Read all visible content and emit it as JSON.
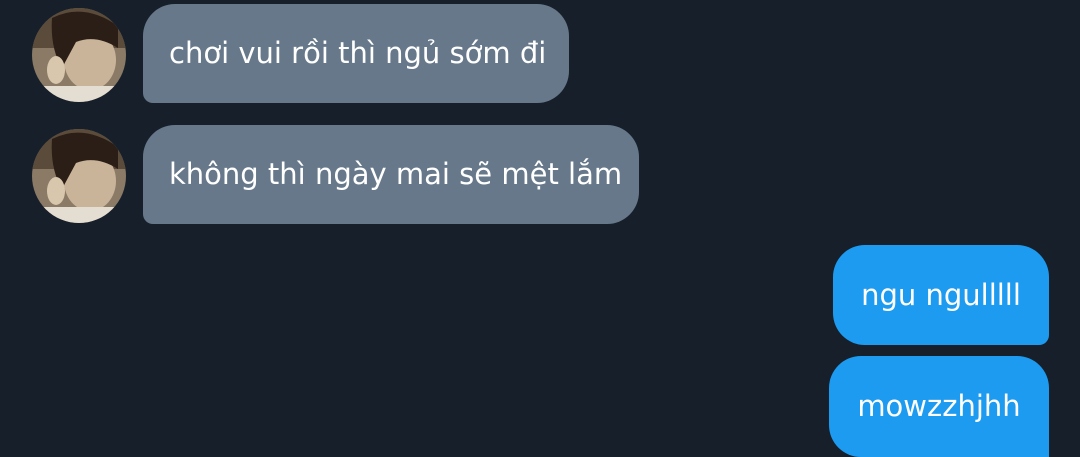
{
  "conversation": {
    "messages": [
      {
        "direction": "incoming",
        "text": "chơi vui rồi thì ngủ sớm đi",
        "avatar": "profile-photo"
      },
      {
        "direction": "incoming",
        "text": "không thì ngày mai sẽ mệt lắm",
        "avatar": "profile-photo"
      },
      {
        "direction": "outgoing",
        "text": "ngu ngulllll"
      },
      {
        "direction": "outgoing",
        "text": "mowzzhjhh"
      }
    ]
  },
  "colors": {
    "background": "#17202a",
    "incoming_bubble": "#66788a",
    "outgoing_bubble": "#1d9bf0",
    "text": "#ffffff"
  }
}
